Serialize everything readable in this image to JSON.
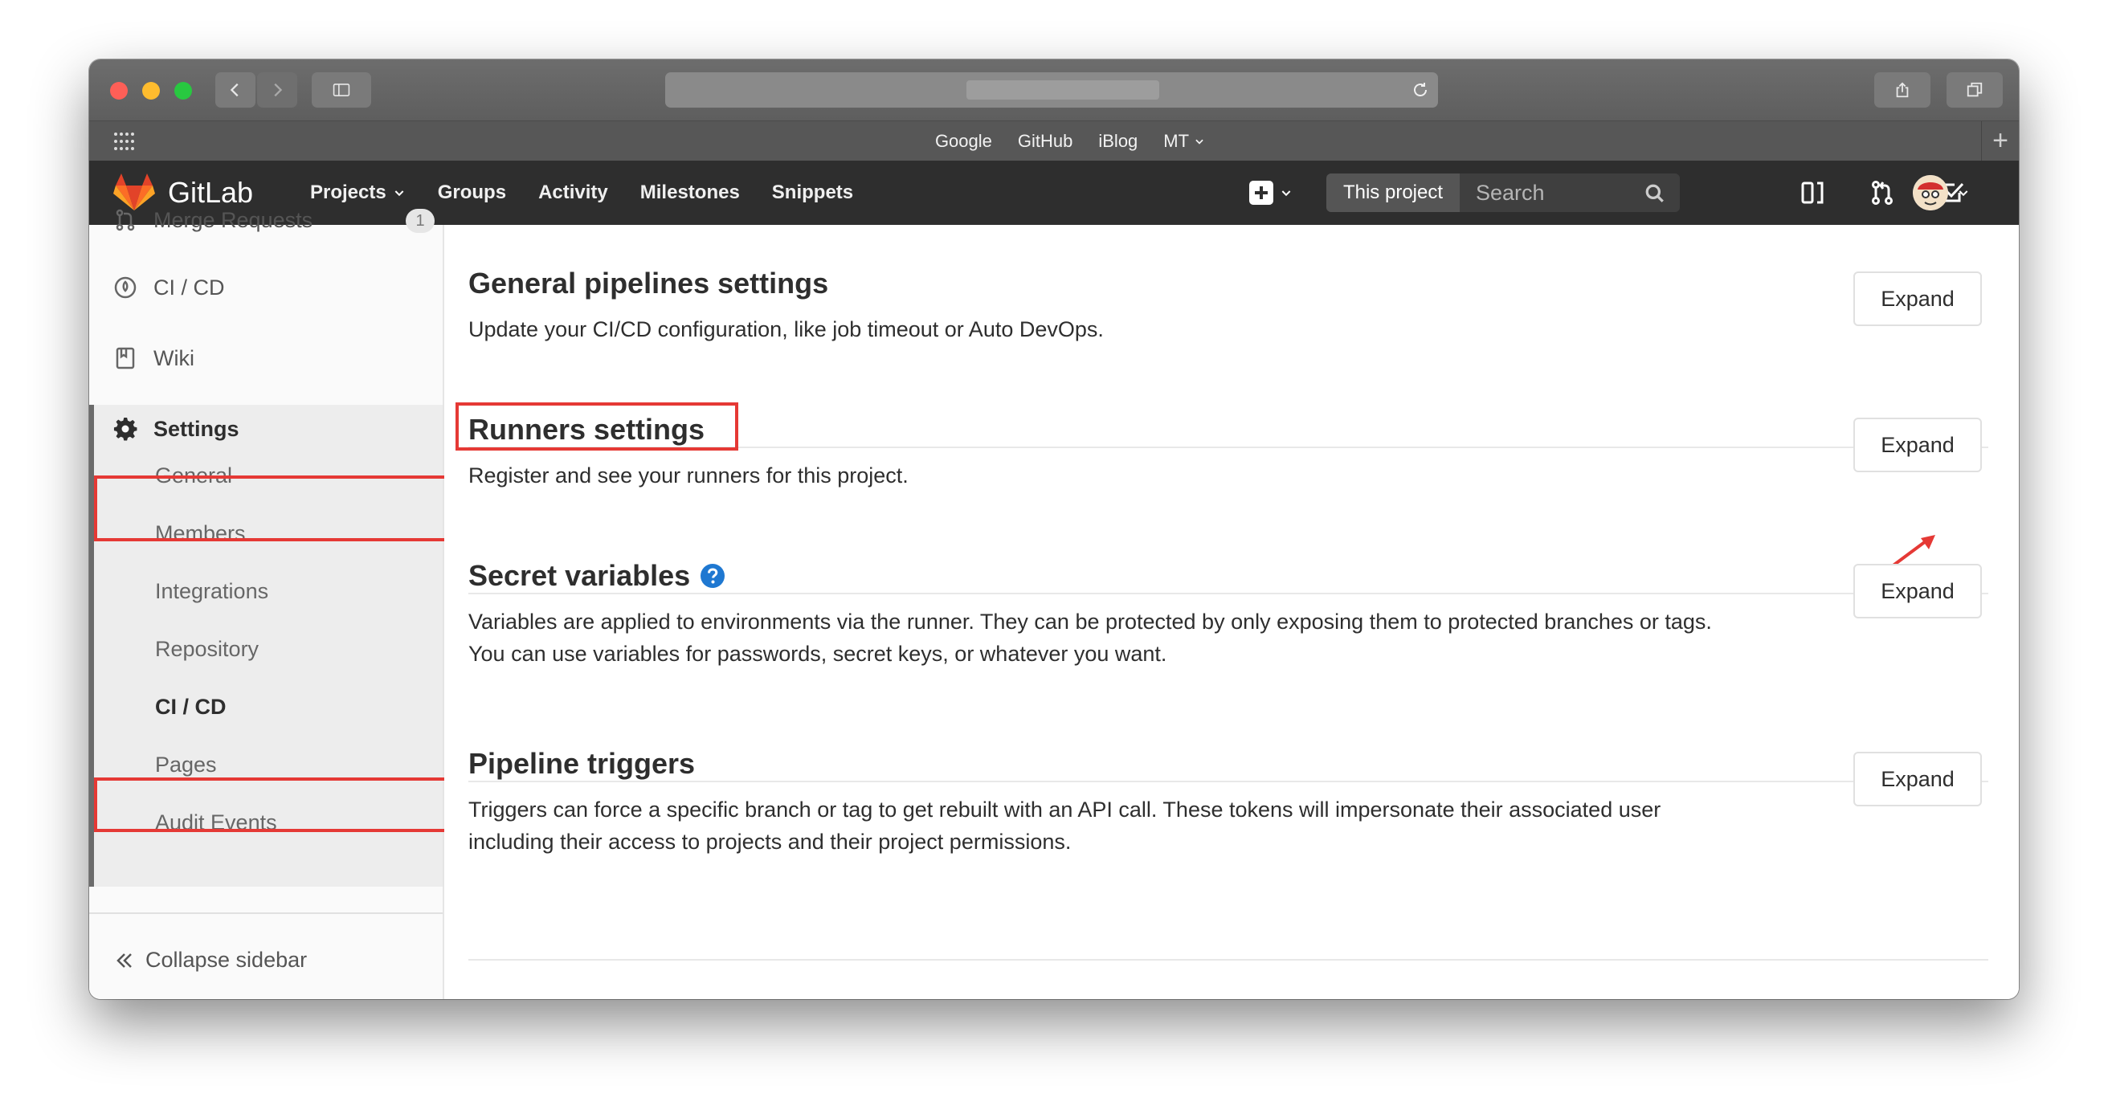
{
  "browser": {
    "favorites": [
      "Google",
      "GitHub",
      "iBlog",
      "MT"
    ]
  },
  "header": {
    "brand": "GitLab",
    "nav": [
      "Projects",
      "Groups",
      "Activity",
      "Milestones",
      "Snippets"
    ],
    "search_scope": "This project",
    "search_placeholder": "Search"
  },
  "sidebar": {
    "merge_requests": "Merge Requests",
    "merge_requests_count": "1",
    "cicd": "CI / CD",
    "wiki": "Wiki",
    "settings": "Settings",
    "settings_items": [
      "General",
      "Members",
      "Integrations",
      "Repository",
      "CI / CD",
      "Pages",
      "Audit Events"
    ],
    "collapse": "Collapse sidebar"
  },
  "sections": [
    {
      "title": "General pipelines settings",
      "description": "Update your CI/CD configuration, like job timeout or Auto DevOps.",
      "button": "Expand"
    },
    {
      "title": "Runners settings",
      "description": "Register and see your runners for this project.",
      "button": "Expand"
    },
    {
      "title": "Secret variables",
      "description_lines": [
        "Variables are applied to environments via the runner. They can be protected by only exposing them to protected branches or tags.",
        "You can use variables for passwords, secret keys, or whatever you want."
      ],
      "button": "Expand"
    },
    {
      "title": "Pipeline triggers",
      "description_lines": [
        "Triggers can force a specific branch or tag to get rebuilt with an API call. These tokens will impersonate their associated user",
        "including their access to projects and their project permissions."
      ],
      "button": "Expand"
    }
  ],
  "colors": {
    "highlight": "#e53935",
    "header_bg": "#2e2e2e",
    "link_blue": "#1f78d1"
  }
}
